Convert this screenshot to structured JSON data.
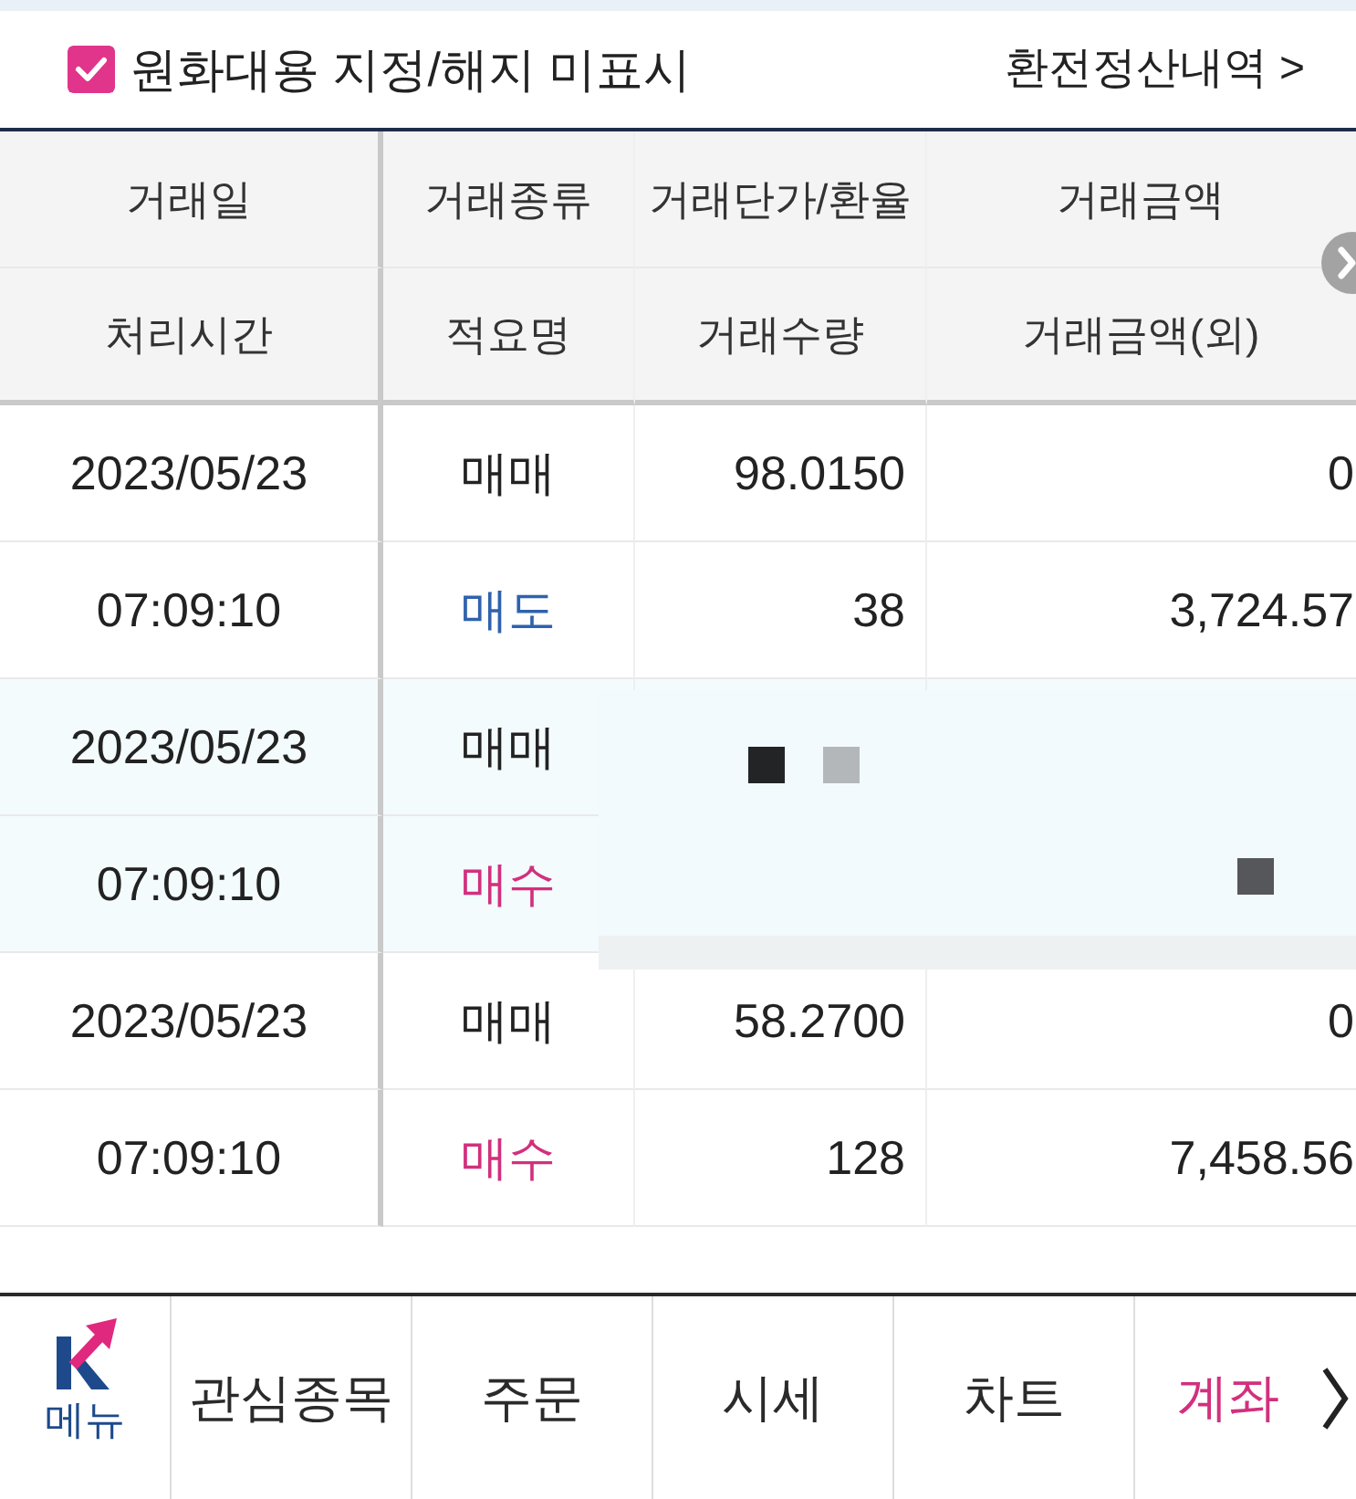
{
  "options": {
    "checkbox": {
      "label": "원화대용 지정/해지 미표시",
      "checked": true
    },
    "link": "환전정산내역 >"
  },
  "table": {
    "header_rows": [
      [
        "거래일",
        "거래종류",
        "거래단가/환율",
        "거래금액"
      ],
      [
        "처리시간",
        "적요명",
        "거래수량",
        "거래금액(외)"
      ]
    ],
    "records": [
      {
        "selected": false,
        "masked": false,
        "date": "2023/05/23",
        "trade_type": "매매",
        "price": "98.0150",
        "amount": "0",
        "time": "07:09:10",
        "summary": {
          "text": "매도",
          "kind": "sell"
        },
        "quantity": "38",
        "amount_foreign": "3,724.57"
      },
      {
        "selected": true,
        "masked": true,
        "date": "2023/05/23",
        "trade_type": "매매",
        "time": "07:09:10",
        "summary": {
          "text": "매수",
          "kind": "buy"
        }
      },
      {
        "selected": false,
        "masked": false,
        "date": "2023/05/23",
        "trade_type": "매매",
        "price": "58.2700",
        "amount": "0",
        "time": "07:09:10",
        "summary": {
          "text": "매수",
          "kind": "buy"
        },
        "quantity": "128",
        "amount_foreign": "7,458.56"
      }
    ]
  },
  "bottom_nav": {
    "menu_label": "메뉴",
    "tabs": [
      {
        "label": "관심종목",
        "selected": false
      },
      {
        "label": "주문",
        "selected": false
      },
      {
        "label": "시세",
        "selected": false
      },
      {
        "label": "차트",
        "selected": false
      },
      {
        "label": "계좌",
        "selected": true
      }
    ]
  }
}
